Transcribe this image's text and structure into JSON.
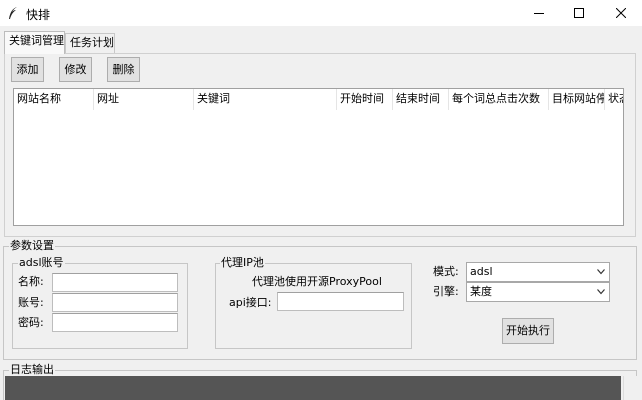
{
  "window": {
    "title": "快排",
    "icon": "feather-icon",
    "minimize": "minimize-icon",
    "maximize": "maximize-icon",
    "close": "close-icon"
  },
  "tabs": [
    {
      "label": "关键词管理",
      "active": true
    },
    {
      "label": "任务计划",
      "active": false
    }
  ],
  "toolbar": {
    "add_label": "添加",
    "edit_label": "修改",
    "delete_label": "删除"
  },
  "table": {
    "columns": [
      "网站名称",
      "网址",
      "关键词",
      "开始时间",
      "结束时间",
      "每个词总点击次数",
      "目标网站停",
      "状态"
    ]
  },
  "params": {
    "title": "参数设置",
    "adsl": {
      "title": "adsl账号",
      "name_label": "名称:",
      "account_label": "账号:",
      "password_label": "密码:",
      "name_value": "",
      "account_value": "",
      "password_value": ""
    },
    "proxy": {
      "title": "代理IP池",
      "note": "代理池使用开源ProxyPool",
      "api_label": "api接口:",
      "api_value": ""
    },
    "mode_label": "模式:",
    "mode_value": "adsl",
    "engine_label": "引擎:",
    "engine_value": "某度",
    "run_label": "开始执行"
  },
  "log": {
    "title": "日志输出",
    "background": "#555555"
  }
}
